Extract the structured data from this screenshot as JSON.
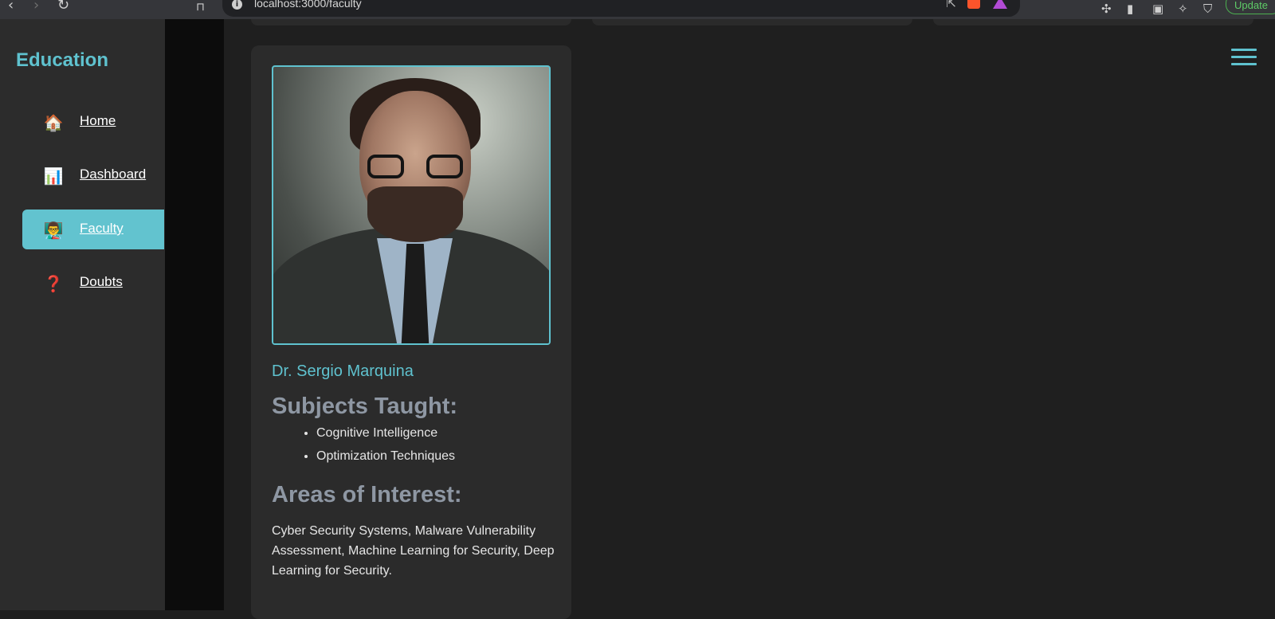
{
  "browser": {
    "url": "localhost:3000/faculty",
    "update_label": "Update",
    "icons": [
      "back-icon",
      "forward-icon",
      "reload-icon",
      "bookmark-icon",
      "info-icon",
      "share-icon",
      "brave-shields-icon",
      "brave-rewards-icon",
      "extensions-icon",
      "sidebar-icon",
      "wallet-icon",
      "leo-icon",
      "vpn-icon"
    ]
  },
  "sidebar": {
    "logo": "Education",
    "items": [
      {
        "label": "Home",
        "icon": "house-icon",
        "glyph": "🏠"
      },
      {
        "label": "Dashboard",
        "icon": "bar-chart-icon",
        "glyph": "📊"
      },
      {
        "label": "Faculty",
        "icon": "teacher-icon",
        "glyph": "👨‍🏫",
        "active": true
      },
      {
        "label": "Doubts",
        "icon": "question-icon",
        "glyph": "❓"
      }
    ]
  },
  "faculty": {
    "name": "Dr. Sergio Marquina",
    "subjects_heading": "Subjects Taught:",
    "subjects": [
      "Cognitive Intelligence",
      "Optimization Techniques"
    ],
    "areas_heading": "Areas of Interest:",
    "areas": "Cyber Security Systems, Malware Vulnerability Assessment, Machine Learning for Security, Deep Learning for Security."
  },
  "colors": {
    "accent": "#5fc2cf",
    "sidebar_bg": "#2c2c2c",
    "card_bg": "#2b2b2b",
    "heading": "#8e97a3"
  }
}
